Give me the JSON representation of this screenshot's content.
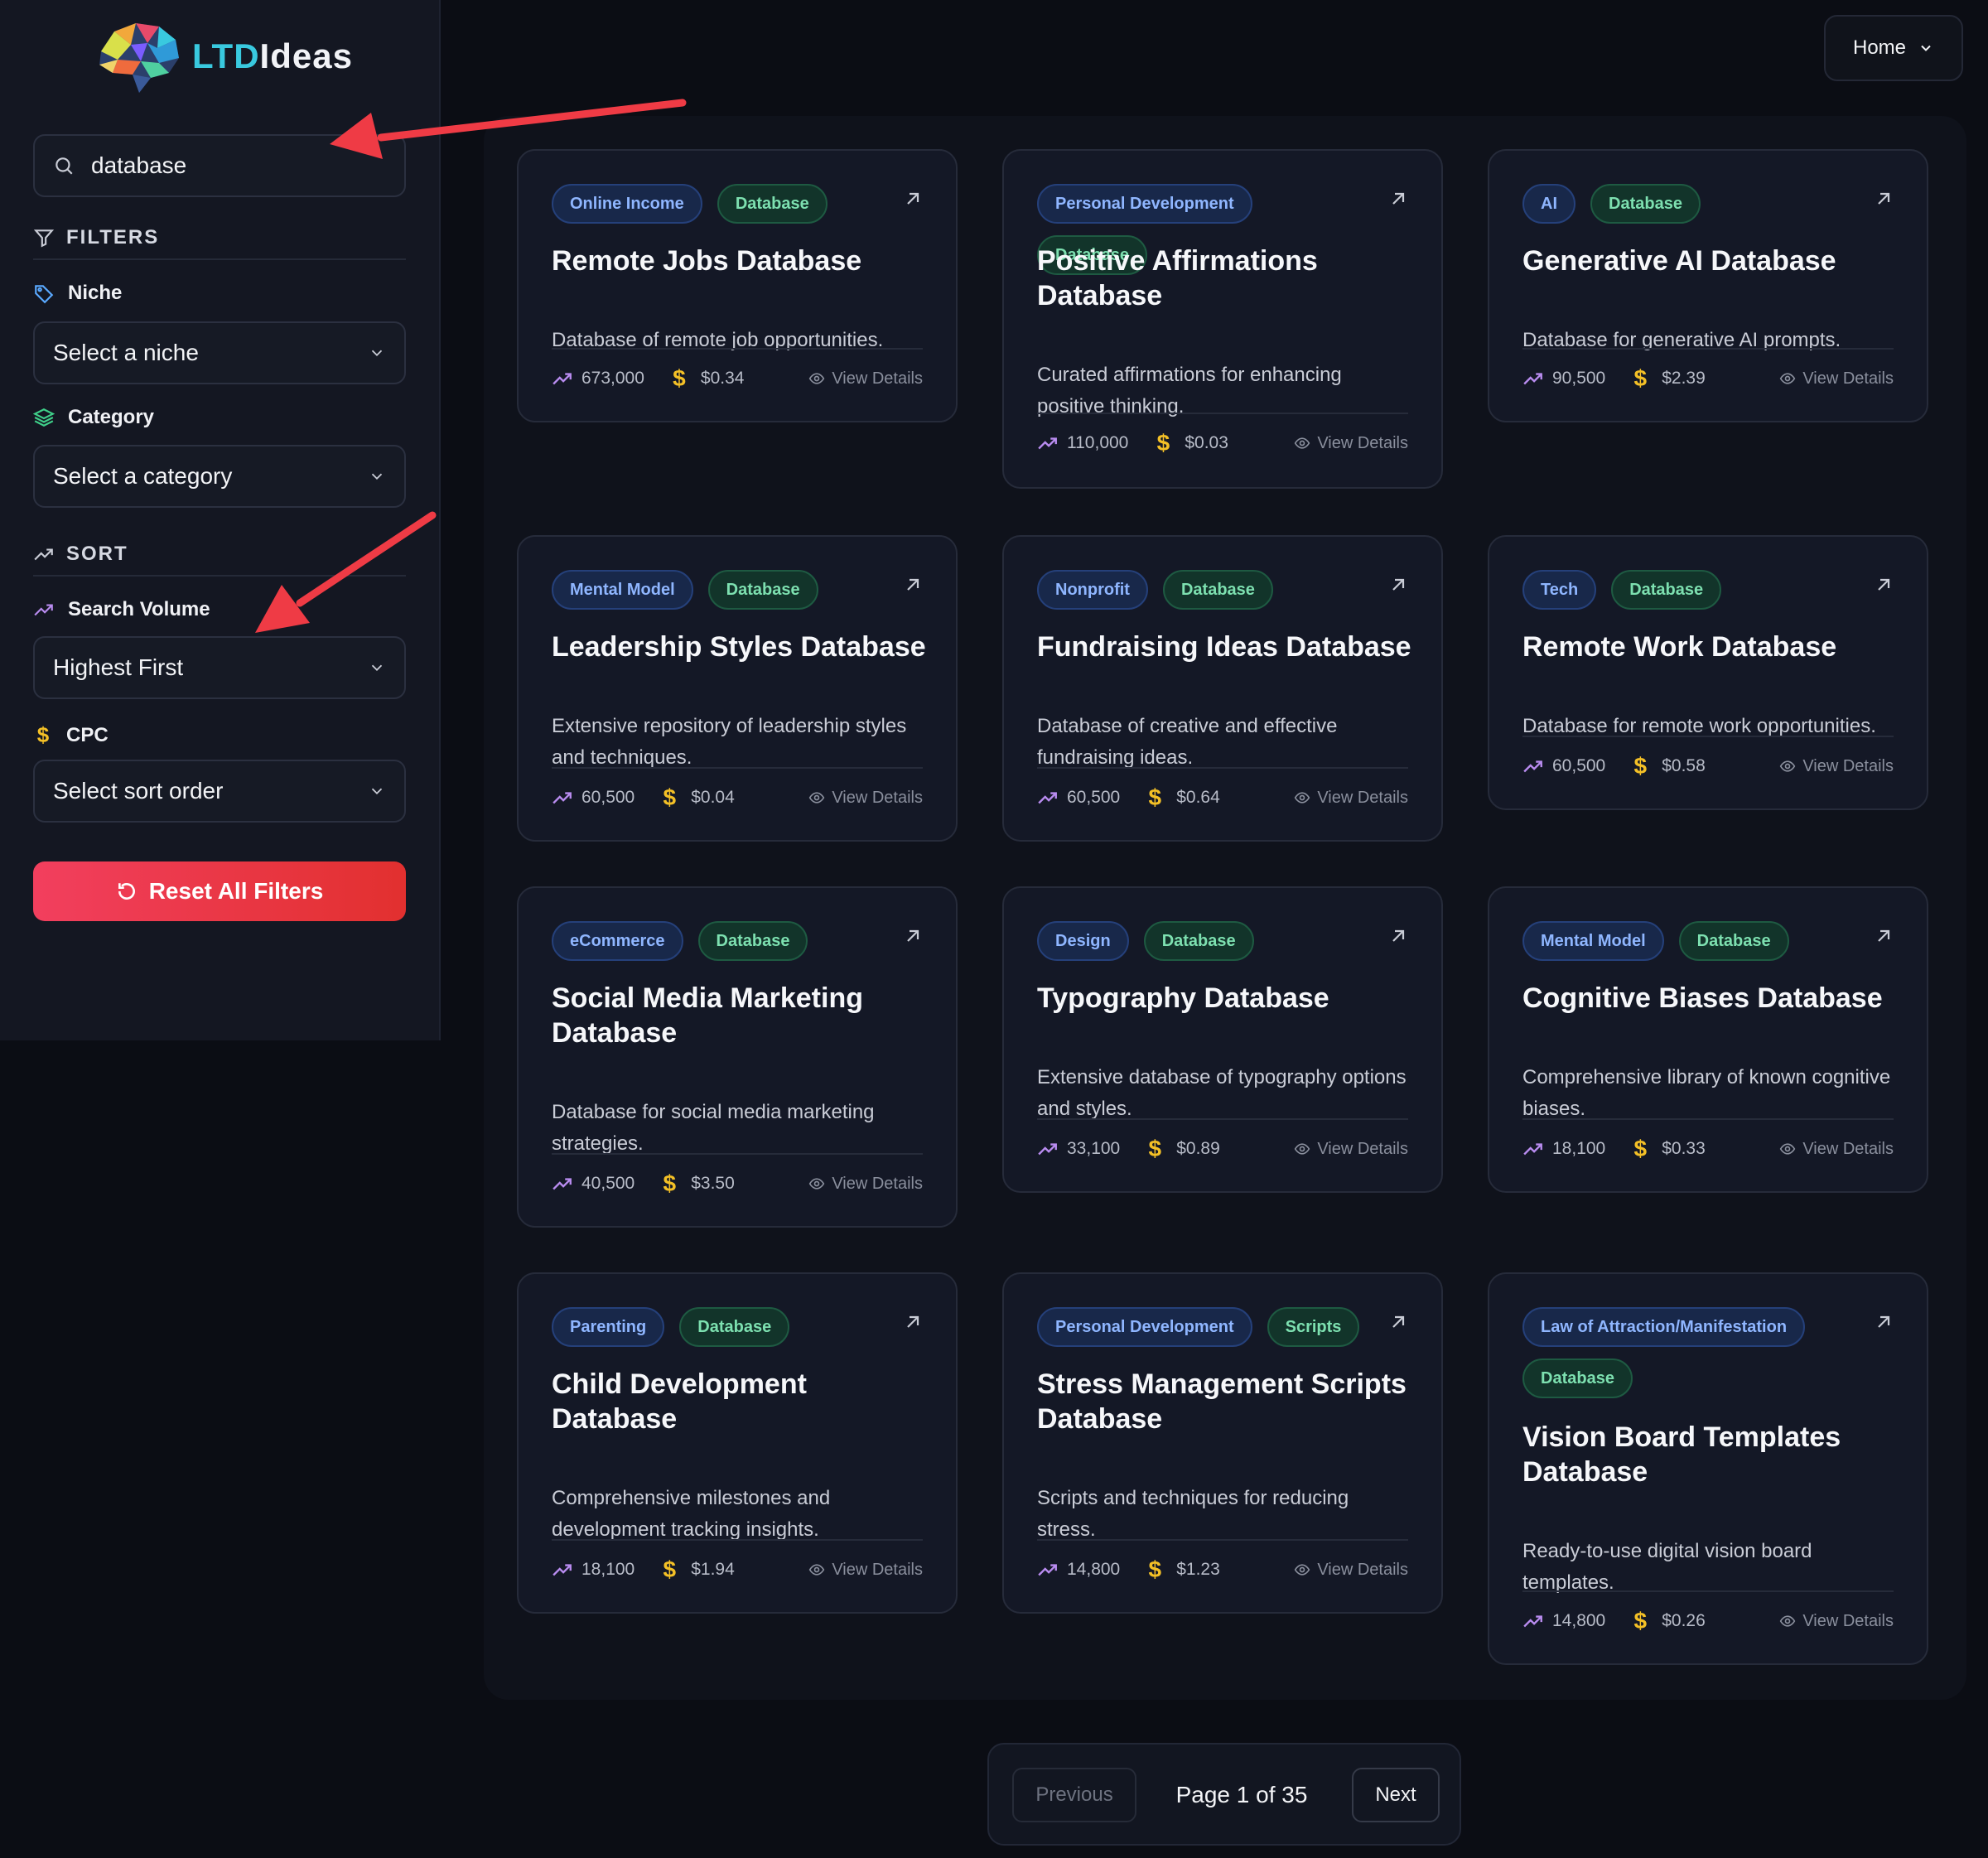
{
  "brand": {
    "ltd": "LTD",
    "ideas": "Ideas"
  },
  "search": {
    "value": "database"
  },
  "filters": {
    "heading": "FILTERS",
    "niche_label": "Niche",
    "niche_value": "Select a niche",
    "category_label": "Category",
    "category_value": "Select a category"
  },
  "sort": {
    "heading": "SORT",
    "volume_label": "Search Volume",
    "volume_value": "Highest First",
    "cpc_label": "CPC",
    "cpc_value": "Select sort order"
  },
  "reset_label": "Reset All Filters",
  "nav": {
    "home_label": "Home"
  },
  "icons": {
    "search": "search-icon",
    "filter": "filter-icon",
    "tag": "tag-icon",
    "layers": "layers-icon",
    "trend": "trending-up-icon",
    "dollar": "dollar-icon",
    "reset": "rotate-ccw-icon",
    "chevron": "chevron-down-icon",
    "external": "arrow-up-right-icon",
    "eye": "eye-icon"
  },
  "colors": {
    "accent_cyan": "#39c9df",
    "reset_red": "#ef3a4f",
    "dollar_yellow": "#f4c026",
    "trend_purple": "#b98cf0"
  },
  "view_details_label": "View Details",
  "cards": [
    {
      "tags": [
        "Online Income",
        "Database"
      ],
      "title": "Remote Jobs Database",
      "description": "Database of remote job opportunities.",
      "volume": "673,000",
      "cpc": "$0.34"
    },
    {
      "tags": [
        "Personal Development",
        "Database"
      ],
      "title": "Positive Affirmations Database",
      "description": "Curated affirmations for enhancing positive thinking.",
      "volume": "110,000",
      "cpc": "$0.03"
    },
    {
      "tags": [
        "AI",
        "Database"
      ],
      "title": "Generative AI Database",
      "description": "Database for generative AI prompts.",
      "volume": "90,500",
      "cpc": "$2.39"
    },
    {
      "tags": [
        "Mental Model",
        "Database"
      ],
      "title": "Leadership Styles Database",
      "description": "Extensive repository of leadership styles and techniques.",
      "volume": "60,500",
      "cpc": "$0.04"
    },
    {
      "tags": [
        "Nonprofit",
        "Database"
      ],
      "title": "Fundraising Ideas Database",
      "description": "Database of creative and effective fundraising ideas.",
      "volume": "60,500",
      "cpc": "$0.64"
    },
    {
      "tags": [
        "Tech",
        "Database"
      ],
      "title": "Remote Work Database",
      "description": "Database for remote work opportunities.",
      "volume": "60,500",
      "cpc": "$0.58"
    },
    {
      "tags": [
        "eCommerce",
        "Database"
      ],
      "title": "Social Media Marketing Database",
      "description": "Database for social media marketing strategies.",
      "volume": "40,500",
      "cpc": "$3.50"
    },
    {
      "tags": [
        "Design",
        "Database"
      ],
      "title": "Typography Database",
      "description": "Extensive database of typography options and styles.",
      "volume": "33,100",
      "cpc": "$0.89"
    },
    {
      "tags": [
        "Mental Model",
        "Database"
      ],
      "title": "Cognitive Biases Database",
      "description": "Comprehensive library of known cognitive biases.",
      "volume": "18,100",
      "cpc": "$0.33"
    },
    {
      "tags": [
        "Parenting",
        "Database"
      ],
      "title": "Child Development Database",
      "description": "Comprehensive milestones and development tracking insights.",
      "volume": "18,100",
      "cpc": "$1.94"
    },
    {
      "tags": [
        "Personal Development",
        "Scripts"
      ],
      "title": "Stress Management Scripts Database",
      "description": "Scripts and techniques for reducing stress.",
      "volume": "14,800",
      "cpc": "$1.23"
    },
    {
      "tags": [
        "Law of Attraction/Manifestation",
        "Database"
      ],
      "title": "Vision Board Templates Database",
      "description": "Ready-to-use digital vision board templates.",
      "volume": "14,800",
      "cpc": "$0.26"
    }
  ],
  "pagination": {
    "previous_label": "Previous",
    "page_label": "Page 1 of 35",
    "next_label": "Next"
  }
}
